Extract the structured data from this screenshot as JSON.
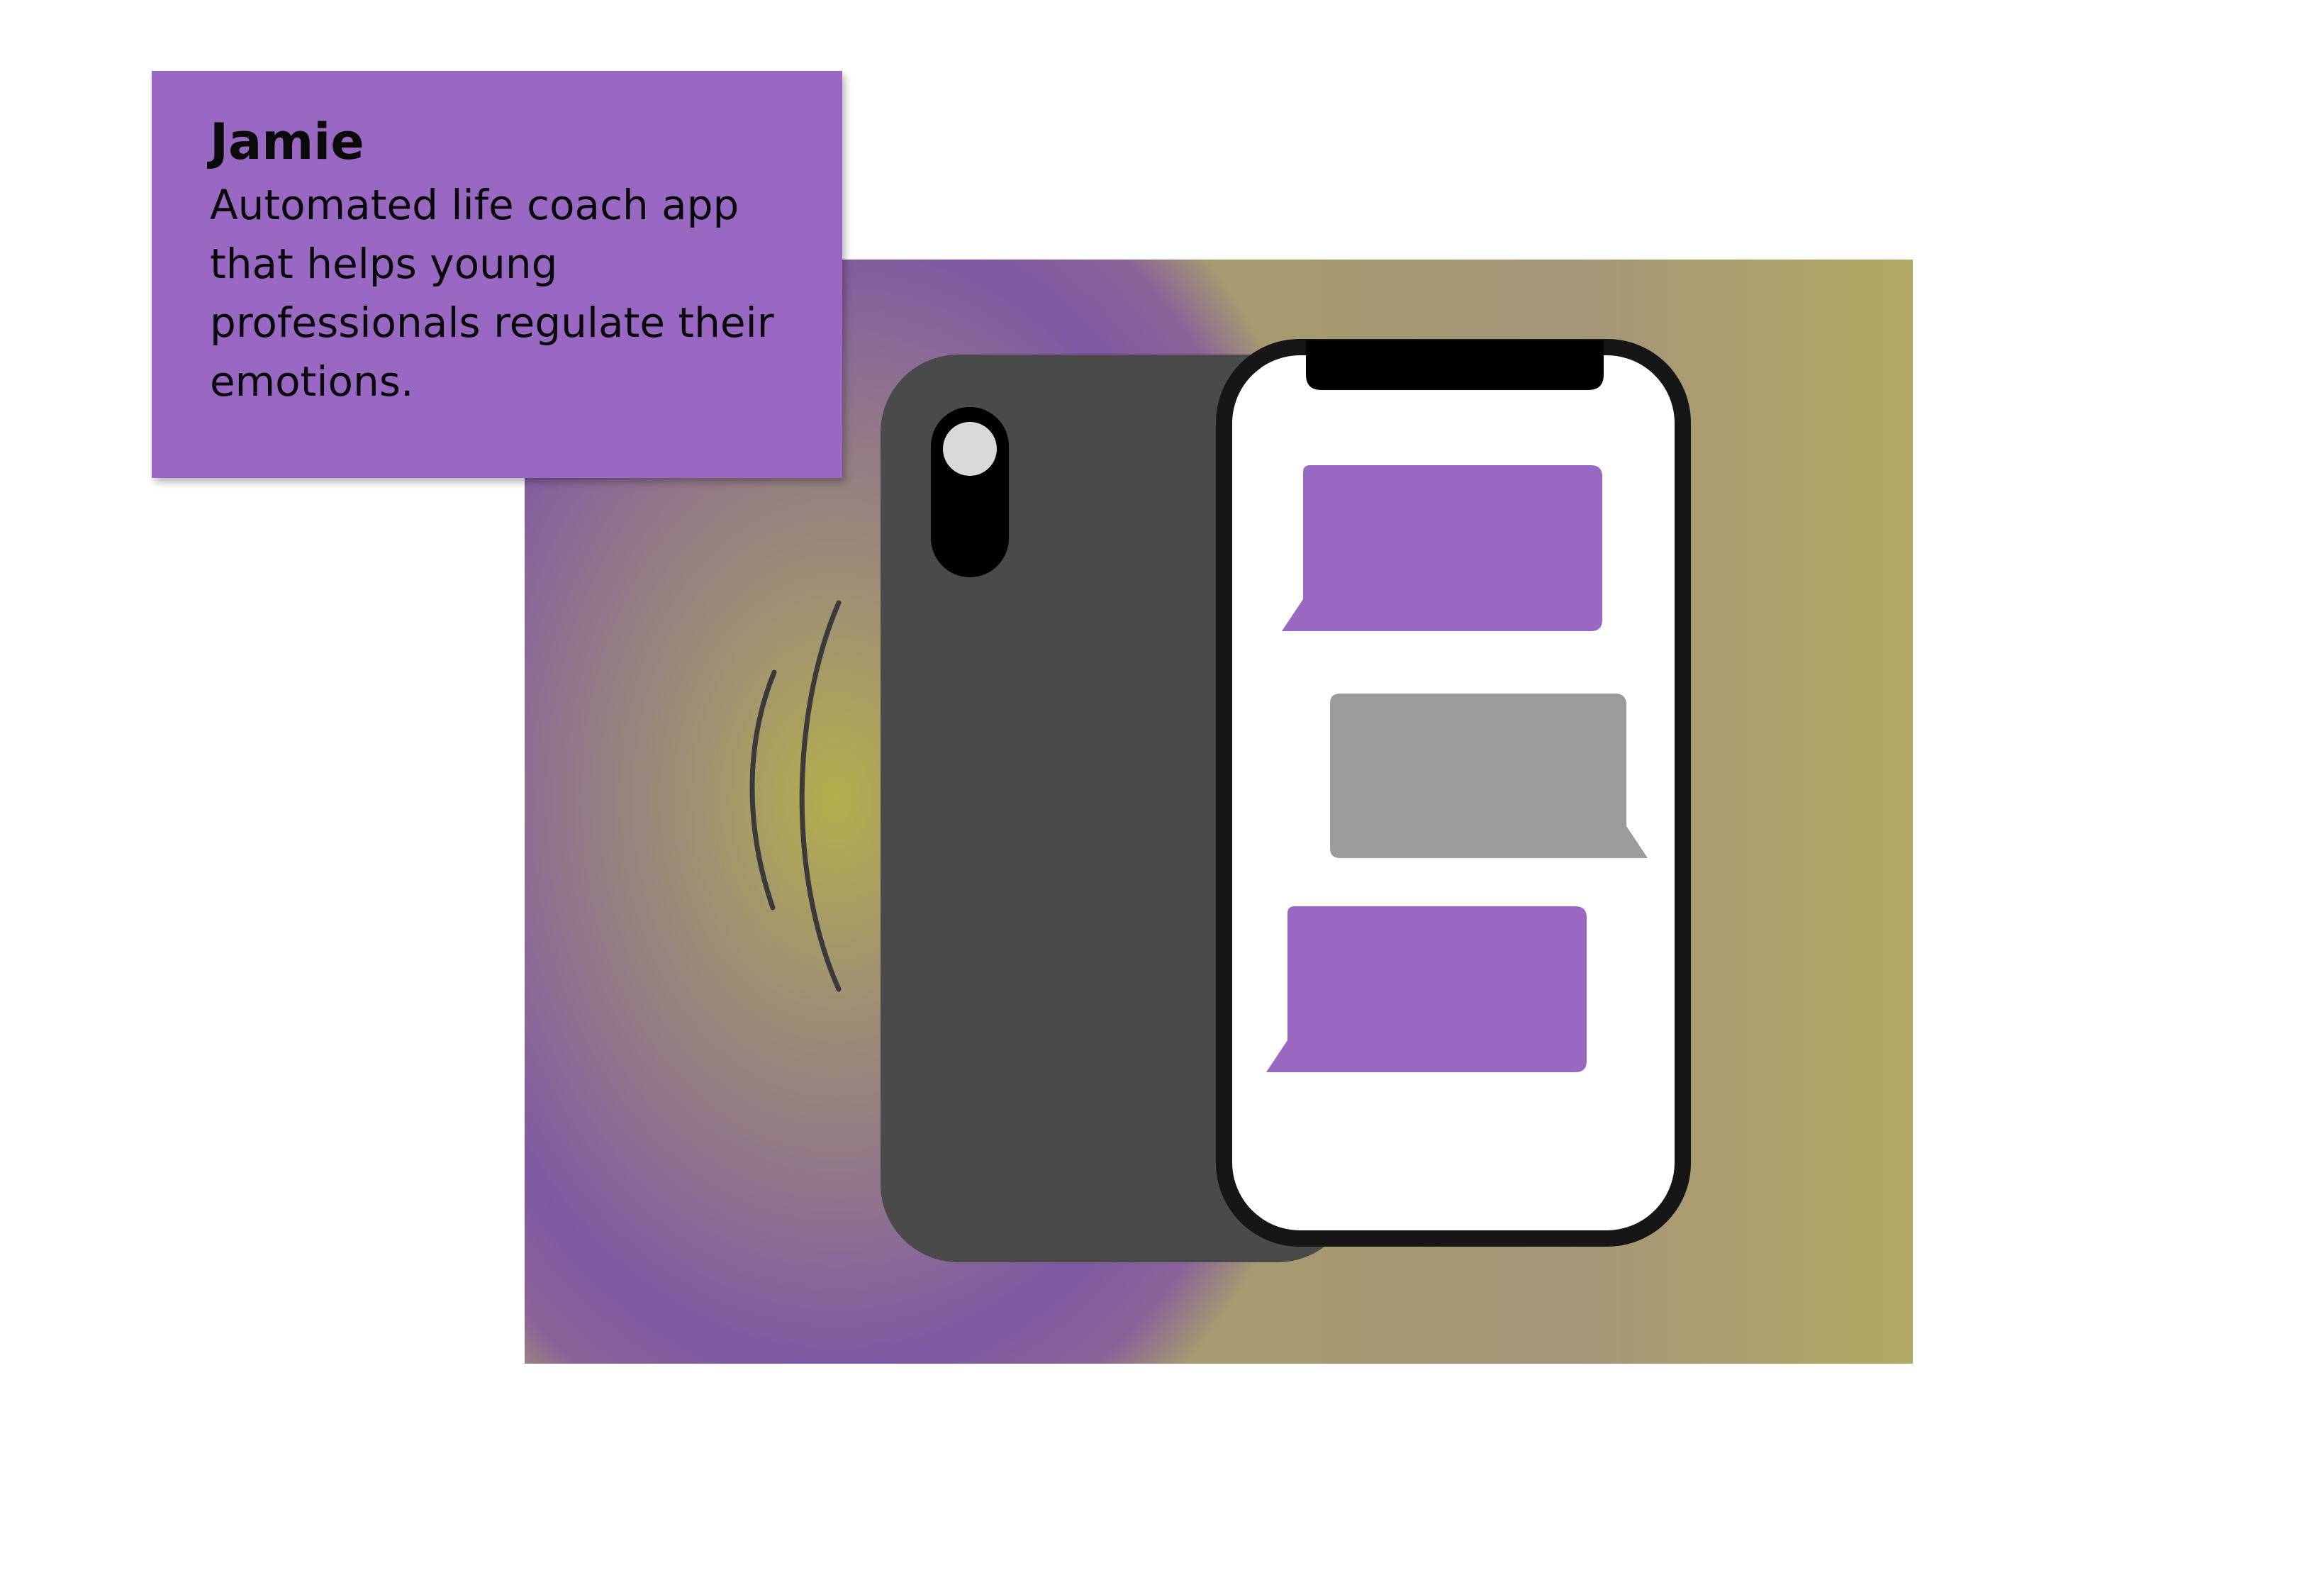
{
  "card": {
    "title": "Jamie",
    "description": "Automated life coach app that helps young professionals regulate their emotions."
  },
  "colors": {
    "card_background": "#9868c3",
    "phone_back": "#4a4a4a",
    "phone_frame": "#161616",
    "screen": "#ffffff",
    "bubble_purple": "#9868c3",
    "bubble_gray": "#9b9b9b",
    "camera_lens": "#d9d9d9",
    "vibration_lines": "#3a3a3a"
  },
  "icons": {
    "back_phone": "phone-back-icon",
    "front_phone": "smartphone-icon",
    "camera": "camera-icon",
    "vibration": "vibration-icon",
    "bubbles": "chat-bubble-icon"
  },
  "chat": {
    "bubbles": [
      {
        "sender": "incoming",
        "color": "purple"
      },
      {
        "sender": "outgoing",
        "color": "gray"
      },
      {
        "sender": "incoming",
        "color": "purple"
      }
    ]
  }
}
